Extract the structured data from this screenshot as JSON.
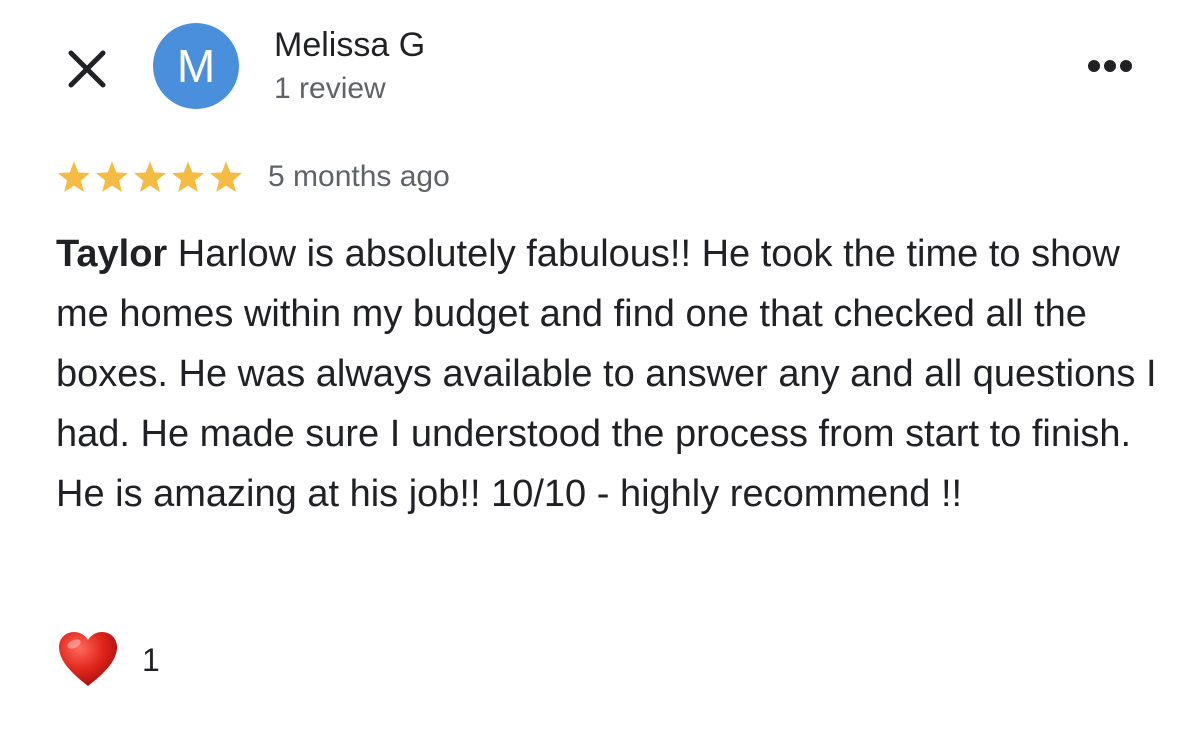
{
  "header": {
    "close_icon": "close-icon",
    "more_icon": "more-options-icon"
  },
  "reviewer": {
    "avatar_initial": "M",
    "avatar_color": "#4a8fdc",
    "name": "Melissa G",
    "review_count": "1 review"
  },
  "review": {
    "rating": 5,
    "rating_max": 5,
    "star_color": "#f6bb42",
    "time_ago": "5 months ago",
    "text_lead": "Taylor",
    "text_body": " Harlow is absolutely fabulous!!  He took the time to show me homes within my budget and find one that checked all the boxes. He was always available to answer any and all questions I had.  He made sure I understood the process from start to finish. He is amazing at his job!! 10/10 - highly recommend !!"
  },
  "reactions": {
    "icon": "heart-icon",
    "count": "1"
  }
}
